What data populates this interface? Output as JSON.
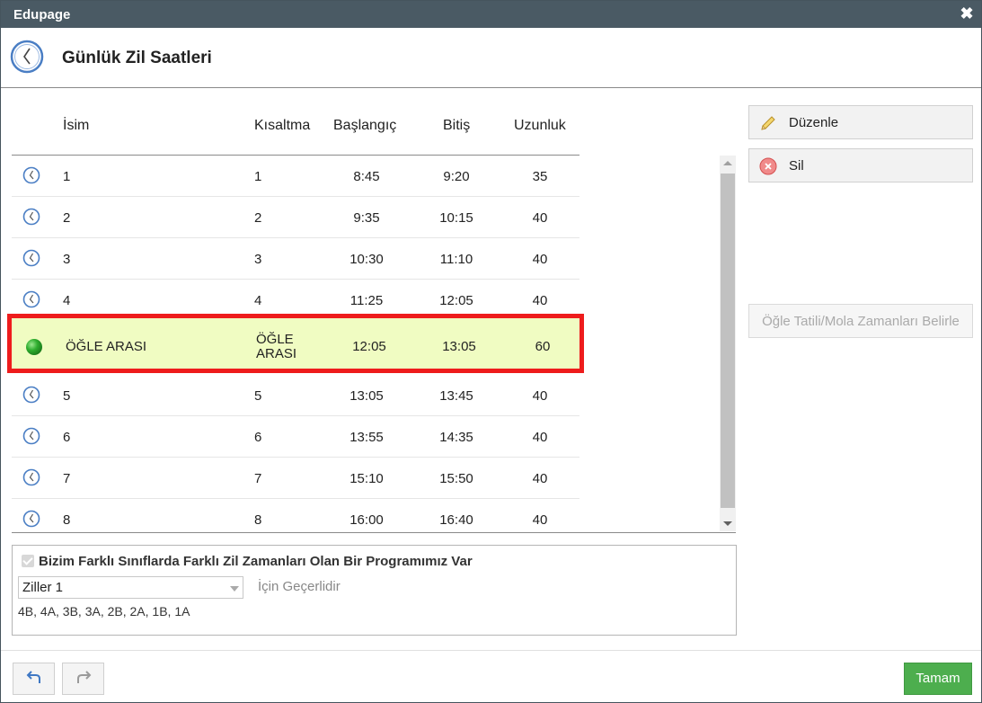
{
  "window": {
    "title": "Edupage",
    "close_glyph": "✖"
  },
  "header": {
    "title": "Günlük Zil Saatleri",
    "icon": "clock-icon"
  },
  "columns": {
    "name": "İsim",
    "abbr": "Kısaltma",
    "start": "Başlangıç",
    "end": "Bitiş",
    "length": "Uzunluk"
  },
  "rows": [
    {
      "name": "1",
      "abbr": "1",
      "start": "8:45",
      "end": "9:20",
      "length": "35",
      "icon": "clock-icon"
    },
    {
      "name": "2",
      "abbr": "2",
      "start": "9:35",
      "end": "10:15",
      "length": "40",
      "icon": "clock-icon"
    },
    {
      "name": "3",
      "abbr": "3",
      "start": "10:30",
      "end": "11:10",
      "length": "40",
      "icon": "clock-icon"
    },
    {
      "name": "4",
      "abbr": "4",
      "start": "11:25",
      "end": "12:05",
      "length": "40",
      "icon": "clock-icon"
    },
    {
      "name": "ÖĞLE ARASI",
      "abbr_line1": "ÖĞLE",
      "abbr_line2": "ARASI",
      "start": "12:05",
      "end": "13:05",
      "length": "60",
      "icon": "green-dot-icon",
      "highlighted": true
    },
    {
      "name": "5",
      "abbr": "5",
      "start": "13:05",
      "end": "13:45",
      "length": "40",
      "icon": "clock-icon"
    },
    {
      "name": "6",
      "abbr": "6",
      "start": "13:55",
      "end": "14:35",
      "length": "40",
      "icon": "clock-icon"
    },
    {
      "name": "7",
      "abbr": "7",
      "start": "15:10",
      "end": "15:50",
      "length": "40",
      "icon": "clock-icon"
    },
    {
      "name": "8",
      "abbr": "8",
      "start": "16:00",
      "end": "16:40",
      "length": "40",
      "icon": "clock-icon"
    }
  ],
  "side_buttons": {
    "edit": "Düzenle",
    "delete": "Sil",
    "break_times": "Öğle Tatili/Mola Zamanları Belirle"
  },
  "settings": {
    "checkbox_label": "Bizim Farklı Sınıflarda Farklı Zil Zamanları Olan Bir Programımız Var",
    "checked": true,
    "select_value": "Ziller 1",
    "valid_for": "İçin Geçerlidir",
    "classes": "4B, 4A, 3B, 3A, 2B, 2A, 1B, 1A"
  },
  "footer": {
    "ok": "Tamam"
  },
  "colors": {
    "titlebar": "#4a5a64",
    "highlight_bg": "#f0fcc2",
    "highlight_border": "#ee1c1c",
    "ok_green": "#4dae4e",
    "clock_blue": "#4a7ec4"
  }
}
